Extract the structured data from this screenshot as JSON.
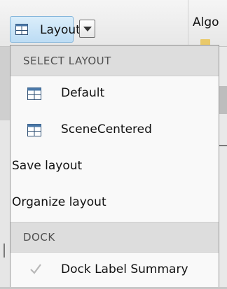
{
  "toolbar": {
    "layout_button_label": "Layout",
    "algo_label": "Algo"
  },
  "menu": {
    "section_layout": "SELECT LAYOUT",
    "layouts": [
      {
        "label": "Default",
        "icon": "grid-layout-icon"
      },
      {
        "label": "SceneCentered",
        "icon": "grid-layout-icon"
      }
    ],
    "save_layout": "Save layout",
    "organize_layout": "Organize layout",
    "section_dock": "DOCK",
    "dock_items": [
      {
        "label": "Dock Label Summary",
        "icon": "checkmark-icon",
        "checked": true
      }
    ]
  },
  "colors": {
    "accent_button": "#bcdcf4",
    "section_header": "#dddddd",
    "menu_background": "#f9f9f9"
  }
}
